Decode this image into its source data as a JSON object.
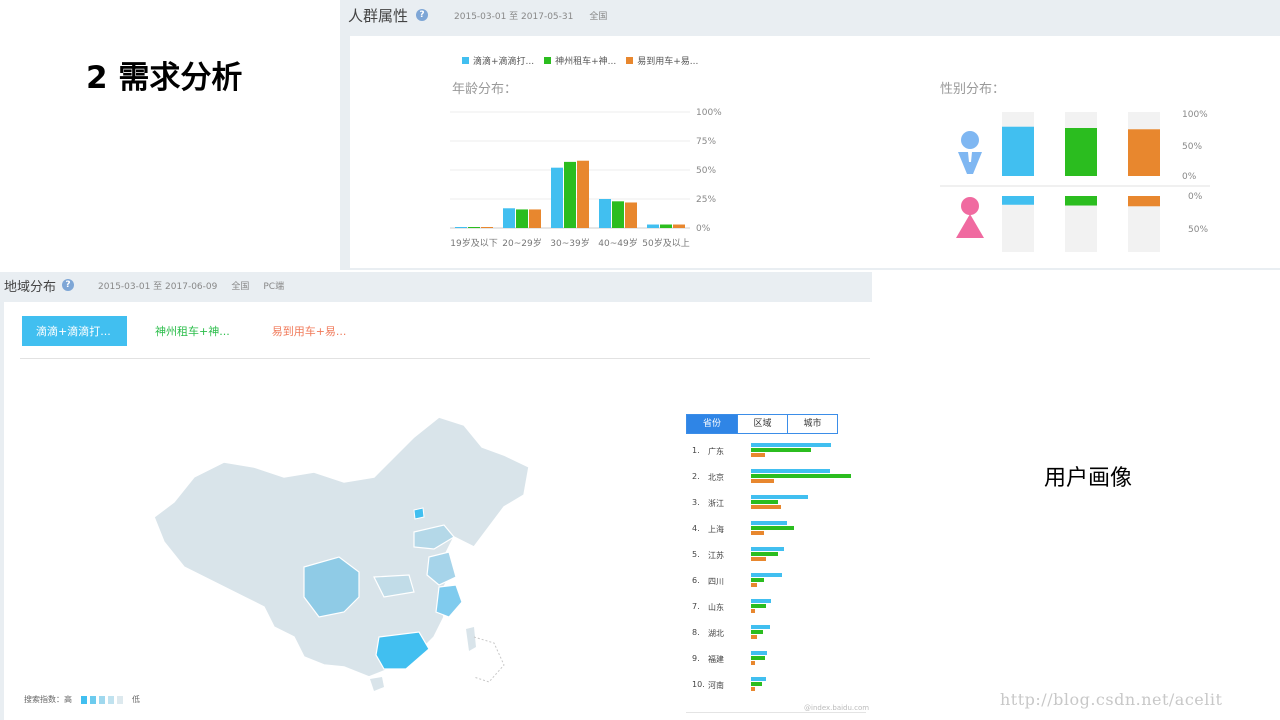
{
  "slide": {
    "title": "2 需求分析",
    "caption": "用户画像",
    "watermark": "http://blog.csdn.net/acelit"
  },
  "crowd": {
    "title": "人群属性",
    "date_range": "2015-03-01 至 2017-05-31",
    "scope": "全国",
    "legend": [
      "滴滴+滴滴打...",
      "神州租车+神...",
      "易到用车+易..."
    ],
    "colors": {
      "didi": "#41bff0",
      "shenzhou": "#2bbd1f",
      "yidao": "#e8872e"
    },
    "age_title": "年龄分布：",
    "gender_title": "性别分布："
  },
  "region": {
    "title": "地域分布",
    "date_range": "2015-03-01 至 2017-06-09",
    "scope": "全国",
    "platform": "PC端",
    "tabs": [
      "滴滴+滴滴打...",
      "神州租车+神...",
      "易到用车+易..."
    ],
    "segments": [
      "省份",
      "区域",
      "城市"
    ],
    "ranking": [
      {
        "rank": "1.",
        "name": "广东",
        "values": [
          80,
          60,
          14
        ]
      },
      {
        "rank": "2.",
        "name": "北京",
        "values": [
          79,
          100,
          23
        ]
      },
      {
        "rank": "3.",
        "name": "浙江",
        "values": [
          57,
          27,
          30
        ]
      },
      {
        "rank": "4.",
        "name": "上海",
        "values": [
          36,
          43,
          13
        ]
      },
      {
        "rank": "5.",
        "name": "江苏",
        "values": [
          33,
          27,
          15
        ]
      },
      {
        "rank": "6.",
        "name": "四川",
        "values": [
          31,
          13,
          6
        ]
      },
      {
        "rank": "7.",
        "name": "山东",
        "values": [
          20,
          15,
          4
        ]
      },
      {
        "rank": "8.",
        "name": "湖北",
        "values": [
          19,
          12,
          6
        ]
      },
      {
        "rank": "9.",
        "name": "福建",
        "values": [
          16,
          14,
          4
        ]
      },
      {
        "rank": "10.",
        "name": "河南",
        "values": [
          15,
          11,
          4
        ]
      }
    ],
    "map_legend_prefix": "搜索指数：高",
    "map_legend_suffix": "低",
    "source": "@index.baidu.com"
  },
  "chart_data": [
    {
      "type": "bar",
      "title": "年龄分布：",
      "categories": [
        "19岁及以下",
        "20~29岁",
        "30~39岁",
        "40~49岁",
        "50岁及以上"
      ],
      "series": [
        {
          "name": "滴滴+滴滴打...",
          "values": [
            0.5,
            17,
            52,
            25,
            3
          ]
        },
        {
          "name": "神州租车+神...",
          "values": [
            0.5,
            16,
            57,
            23,
            3
          ]
        },
        {
          "name": "易到用车+易...",
          "values": [
            0.5,
            16,
            58,
            22,
            3
          ]
        }
      ],
      "yticks": [
        "0%",
        "25%",
        "50%",
        "75%",
        "100%"
      ],
      "ylim": [
        0,
        100
      ]
    },
    {
      "type": "bar",
      "title": "性别分布：",
      "categories": [
        "男",
        "女"
      ],
      "series": [
        {
          "name": "滴滴+滴滴打...",
          "values": [
            77,
            23
          ]
        },
        {
          "name": "神州租车+神...",
          "values": [
            75,
            25
          ]
        },
        {
          "name": "易到用车+易...",
          "values": [
            73,
            27
          ]
        }
      ],
      "yticks_top": [
        "100%",
        "50%",
        "0%"
      ],
      "yticks_bottom": [
        "0%",
        "50%"
      ],
      "ylim": [
        0,
        100
      ]
    }
  ]
}
